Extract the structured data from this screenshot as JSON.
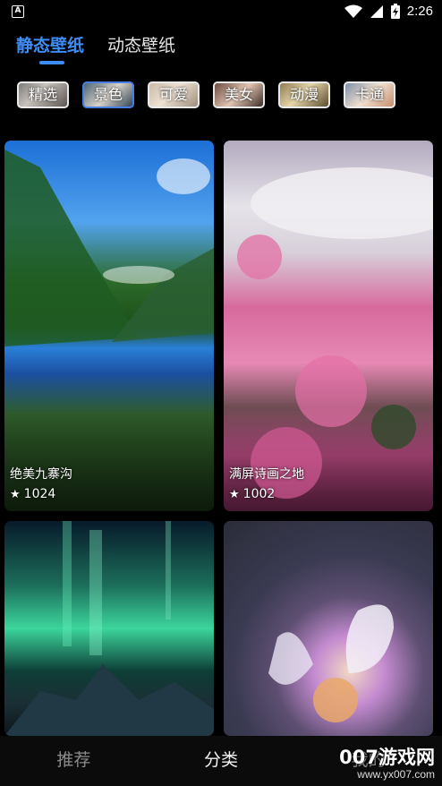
{
  "status_bar": {
    "time": "2:26",
    "left_icon": "A",
    "icons": [
      "wifi-icon",
      "signal-icon",
      "battery-charging-icon"
    ]
  },
  "tabs": [
    {
      "label": "静态壁纸",
      "active": true
    },
    {
      "label": "动态壁纸",
      "active": false
    }
  ],
  "categories": [
    {
      "label": "精选",
      "selected": false
    },
    {
      "label": "景色",
      "selected": true
    },
    {
      "label": "可爱",
      "selected": false
    },
    {
      "label": "美女",
      "selected": false
    },
    {
      "label": "动漫",
      "selected": false
    },
    {
      "label": "卡通",
      "selected": false
    }
  ],
  "wallpapers": [
    {
      "title": "绝美九寨沟",
      "stars": "1024"
    },
    {
      "title": "满屏诗画之地",
      "stars": "1002"
    },
    {
      "title": "",
      "stars": ""
    },
    {
      "title": "",
      "stars": ""
    }
  ],
  "bottom_nav": [
    {
      "label": "推荐",
      "active": false
    },
    {
      "label": "分类",
      "active": true
    },
    {
      "label": "我的",
      "active": false
    }
  ],
  "watermark": {
    "brand": "007游戏网",
    "site": "www.yx007.com"
  },
  "colors": {
    "accent": "#3e8df5",
    "background": "#000000"
  }
}
